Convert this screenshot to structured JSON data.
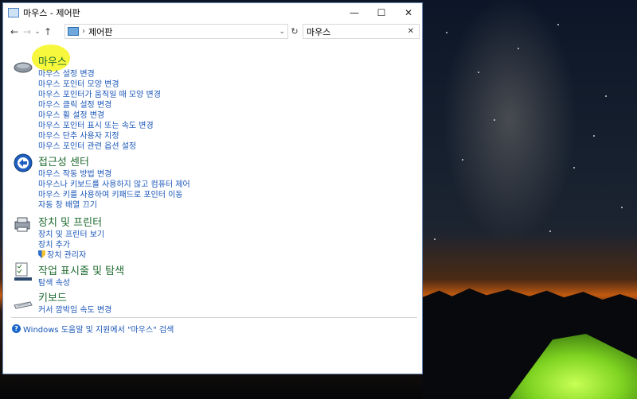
{
  "window": {
    "title": "마우스 - 제어판",
    "controls": {
      "minimize": "—",
      "maximize": "☐",
      "close": "✕"
    }
  },
  "nav": {
    "back": "←",
    "forward": "→",
    "recent": "⌄",
    "up": "↑"
  },
  "address": {
    "separator": "›",
    "path": "제어판",
    "dropdown": "⌄",
    "refresh": "↻"
  },
  "search": {
    "value": "마우스",
    "clear": "✕"
  },
  "groups": [
    {
      "title": "마우스",
      "icon": "mouse-icon",
      "links": [
        "마우스 설정 변경",
        "마우스 포인터 모양 변경",
        "마우스 포인터가 움직일 때 모양 변경",
        "마우스 클릭 설정 변경",
        "마우스 휠 설정 변경",
        "마우스 포인터 표시 또는 속도 변경",
        "마우스 단추 사용자 지정",
        "마우스 포인터 관련 옵션 설정"
      ]
    },
    {
      "title": "접근성 센터",
      "icon": "ease-of-access-icon",
      "links": [
        "마우스 작동 방법 변경",
        "마우스나 키보드를 사용하지 않고 컴퓨터 제어",
        "마우스 키를 사용하여 키패드로 포인터 이동",
        "자동 창 배열 끄기"
      ]
    },
    {
      "title": "장치 및 프린터",
      "icon": "printer-icon",
      "links": [
        "장치 및 프린터 보기",
        "장치 추가",
        "장치 관리자"
      ]
    },
    {
      "title": "작업 표시줄 및 탐색",
      "icon": "taskbar-icon",
      "links": [
        "탐색 속성"
      ]
    },
    {
      "title": "키보드",
      "icon": "keyboard-icon",
      "links": [
        "커서 깜박임 속도 변경"
      ]
    }
  ],
  "help": {
    "icon": "?",
    "text": "Windows 도움말 및 지원에서 \"마우스\" 검색"
  },
  "colors": {
    "title_green": "#1e6a2f",
    "link_blue": "#1a56b8",
    "highlight": "#f7f733"
  }
}
